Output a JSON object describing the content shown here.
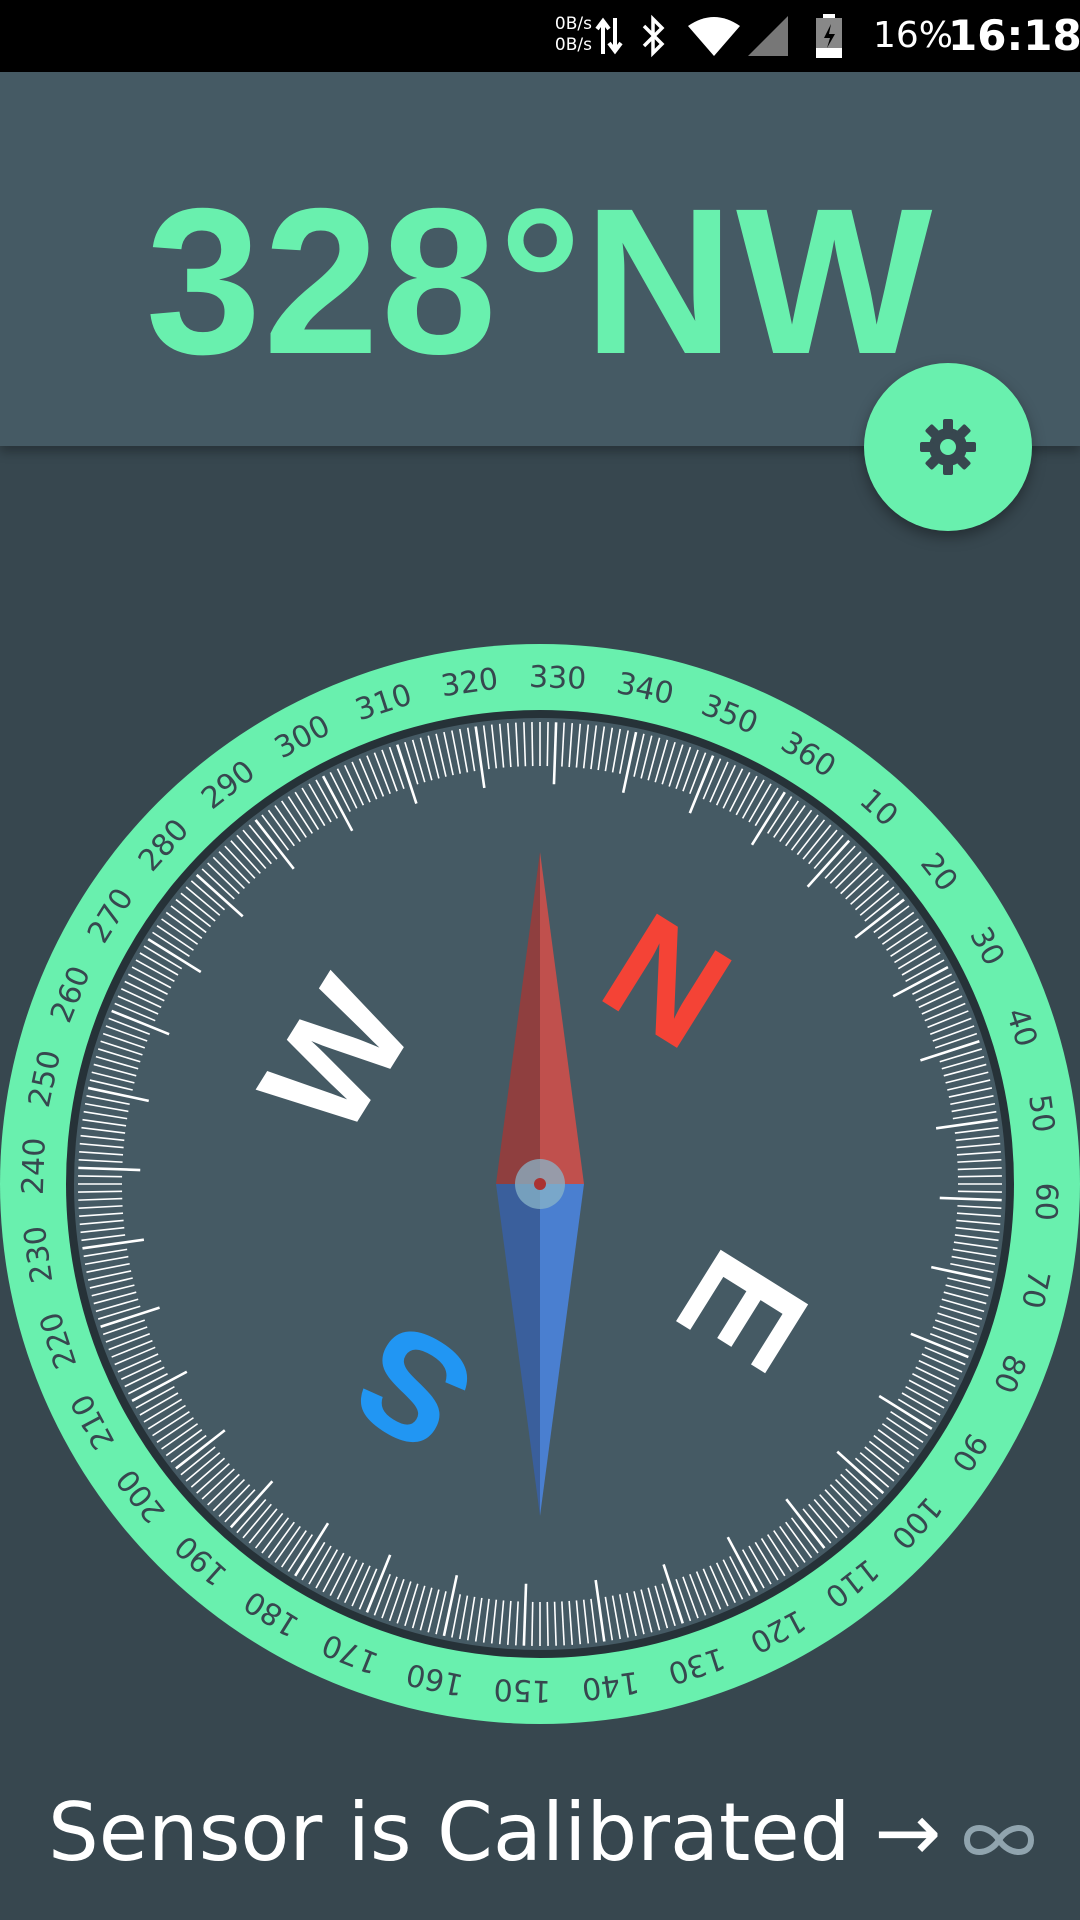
{
  "status_bar": {
    "net_up": "0B/s",
    "net_down": "0B/s",
    "battery": "16%",
    "time": "16:18"
  },
  "header": {
    "heading": "328°NW"
  },
  "compass": {
    "heading_degrees": 328,
    "cardinals": {
      "N": "N",
      "E": "E",
      "S": "S",
      "W": "W"
    },
    "scale_labels": [
      "10",
      "20",
      "30",
      "40",
      "50",
      "60",
      "70",
      "80",
      "90",
      "100",
      "110",
      "120",
      "130",
      "140",
      "150",
      "160",
      "170",
      "180",
      "190",
      "200",
      "210",
      "220",
      "230",
      "240",
      "250",
      "260",
      "270",
      "280",
      "290",
      "300",
      "310",
      "320",
      "330",
      "340",
      "350",
      "360"
    ],
    "colors": {
      "ring": "#69f0ae",
      "face": "#455a64",
      "north": "#f44336",
      "south": "#2196f3",
      "needle_north": "#c0504d",
      "needle_south": "#4a7fd0"
    }
  },
  "footer": {
    "status": "Sensor is Calibrated",
    "arrow": "→"
  },
  "icons": {
    "settings": "gear-icon",
    "calibration": "infinity-icon"
  }
}
